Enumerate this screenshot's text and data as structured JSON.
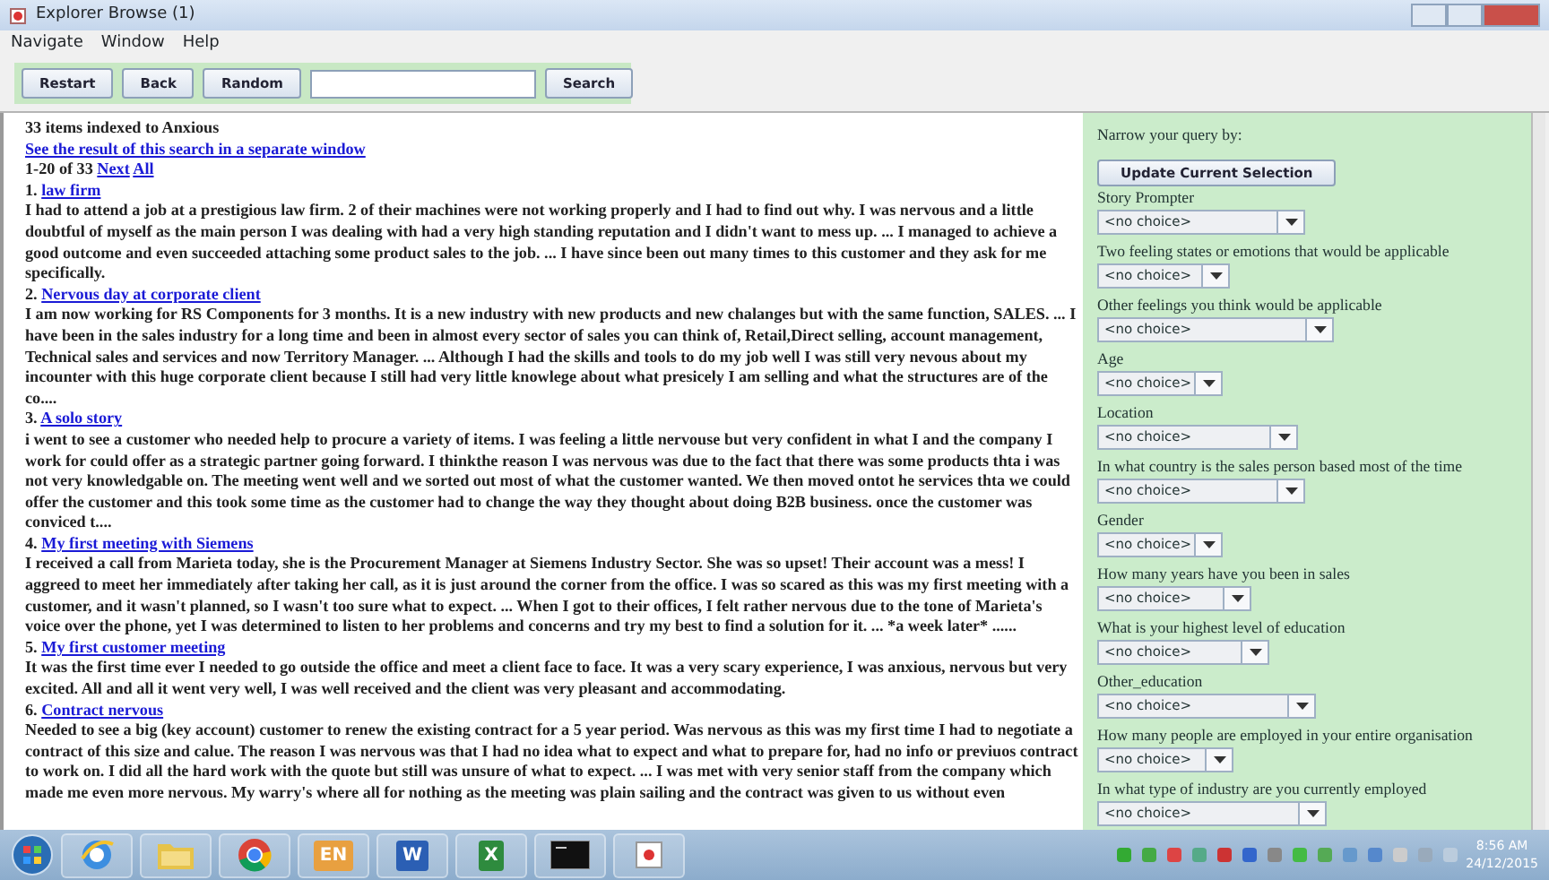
{
  "window": {
    "title": "Explorer Browse (1)"
  },
  "menu": [
    "Navigate",
    "Window",
    "Help"
  ],
  "toolbar": {
    "buttons": [
      "Restart",
      "Back",
      "Random"
    ],
    "search_button": "Search"
  },
  "results": {
    "summary": "33 items indexed to Anxious",
    "separate_link": "See the result of this search in a separate window",
    "range": "1-20 of 33",
    "next": "Next",
    "all": "All",
    "items": [
      {
        "number": "1.",
        "title": "law firm",
        "text": "I had to attend a job at a prestigious law firm. 2 of their machines were not working properly and I had to find out why. I was nervous and a little doubtful of myself as the main person I was dealing with had a very high standing reputation and I didn't want to mess up. ... I managed to achieve a good outcome and even succeeded attaching some product sales to the job. ... I have since been out many times to this customer and they ask for me specifically."
      },
      {
        "number": "2.",
        "title": "Nervous day at corporate client",
        "text": "I am now working for RS Components for 3 months. It is a new industry with new products and new chalanges but with the same function, SALES. ... I have been in the sales industry for a long time and been in almost every sector of sales you can think of, Retail,Direct selling, account management, Technical sales and services and now Territory Manager. ... Although I had the skills and tools to do my job well I was still very nevous about my incounter with this huge corporate client because I still had very little knowlege about what presicely I am selling and what the structures are of the co...."
      },
      {
        "number": "3.",
        "title": "A solo story",
        "text": "i went to see a customer who needed help to procure a variety of items. I was feeling a little nervouse but very confident in what I and the company I work for could offer as a strategic partner going forward. I thinkthe reason I was nervous was due to the fact that there was some products thta i was not very knowledgable on. The meeting went well and we sorted out most of what the customer wanted. We then moved ontot he services thta we could offer the customer and this took some time as the customer had to change the way they thought about doing B2B business. once the customer was conviced t...."
      },
      {
        "number": "4.",
        "title": "My first meeting with Siemens",
        "text": "I received a call from Marieta today, she is the Procurement Manager at Siemens Industry Sector. She was so upset! Their account was a mess! I aggreed to meet her immediately after taking her call, as it is just around the corner from the office. I was so scared as this was my first meeting with a customer, and it wasn't planned, so I wasn't too sure what to expect. ... When I got to their offices, I felt rather nervous due to the tone of Marieta's voice over the phone, yet I was determined to listen to her problems and concerns and try my best to find a solution for it. ... *a week later* ......"
      },
      {
        "number": "5.",
        "title": "My first customer meeting ",
        "text": "It was the first time ever I needed to go outside the office and meet a client face to face. It was a very scary experience, I was anxious, nervous but very excited. All and all it went very well, I was well received and the client was very pleasant and accommodating."
      },
      {
        "number": "6.",
        "title": "Contract nervous",
        "text": "Needed to see a big (key account) customer to renew the existing contract for a 5 year period. Was nervous as this was my first time I had to negotiate a contract of this size and calue. The reason I was nervous was that I had no idea what to expect and what to prepare for, had no info or previuos contract to work on. I did all the hard work with the quote but still was unsure of what to expect. ... I was met with very senior staff from the company which made me even more nervous. My warry's where all for nothing as the meeting was plain sailing and the contract was given to us without even"
      }
    ]
  },
  "filters": {
    "heading": "Narrow your query by:",
    "update_button": "Update Current Selection",
    "fields": [
      {
        "label": "Story Prompter",
        "value": "<no choice>"
      },
      {
        "label": "Two feeling states or emotions that would be applicable",
        "value": "<no choice>"
      },
      {
        "label": "Other feelings you think would be applicable",
        "value": "<no choice>"
      },
      {
        "label": "Age",
        "value": "<no choice>"
      },
      {
        "label": "Location",
        "value": "<no choice>"
      },
      {
        "label": "In what country is the sales person based most of the time",
        "value": "<no choice>"
      },
      {
        "label": "Gender",
        "value": "<no choice>"
      },
      {
        "label": "How many years have you been in sales",
        "value": "<no choice>"
      },
      {
        "label": "What is your highest level of education",
        "value": "<no choice>"
      },
      {
        "label": "Other_education",
        "value": "<no choice>"
      },
      {
        "label": "How many people are employed in your entire organisation",
        "value": "<no choice>"
      },
      {
        "label": "In what type of industry are you currently employed",
        "value": "<no choice>"
      }
    ]
  },
  "taskbar": {
    "apps": [
      {
        "kind": "browser"
      },
      {
        "kind": "folder"
      },
      {
        "kind": "chrome"
      },
      {
        "kind": "lang",
        "glyph": "EN"
      },
      {
        "kind": "word",
        "glyph": "W"
      },
      {
        "kind": "excel",
        "glyph": "X"
      },
      {
        "kind": "terminal"
      },
      {
        "kind": "java"
      }
    ],
    "time": "8:56 AM",
    "date": "24/12/2015"
  }
}
